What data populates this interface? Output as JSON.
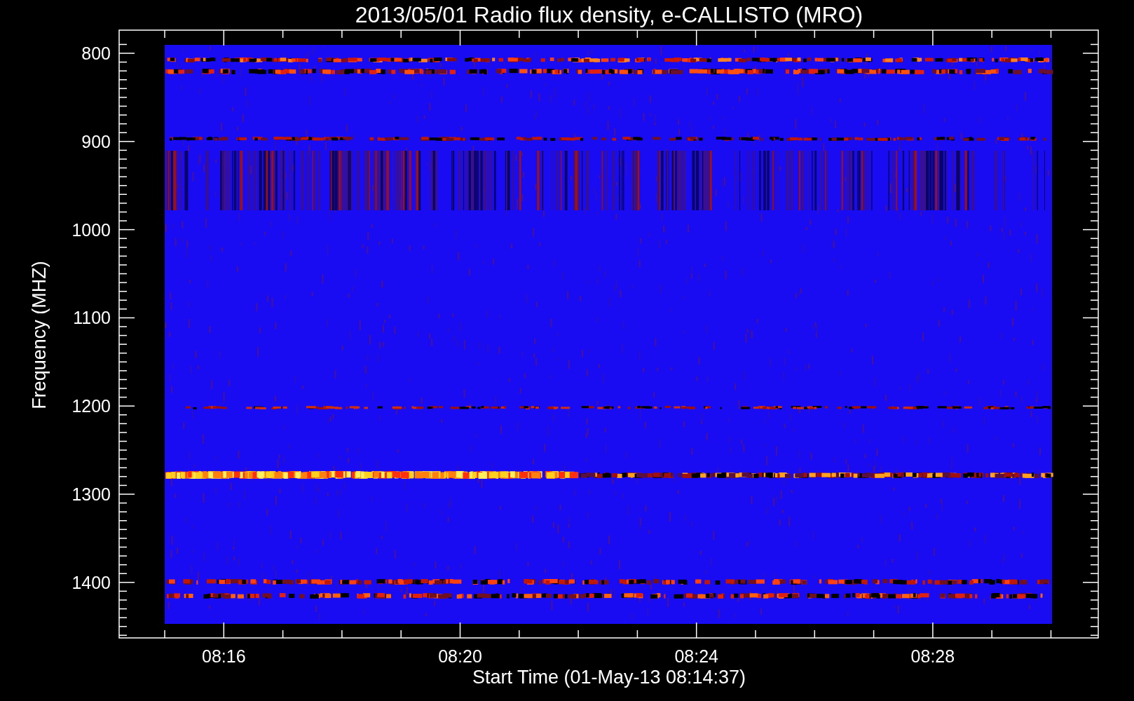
{
  "plot": {
    "title": "2013/05/01  Radio flux density, e-CALLISTO (MRO)",
    "ylabel": "Frequency (MHZ)",
    "xlabel": "Start Time (01-May-13 08:14:37)",
    "yticks": [
      "800",
      "900",
      "1000",
      "1100",
      "1200",
      "1300",
      "1400"
    ],
    "xticks": [
      "08:16",
      "08:20",
      "08:24",
      "08:28"
    ]
  }
}
